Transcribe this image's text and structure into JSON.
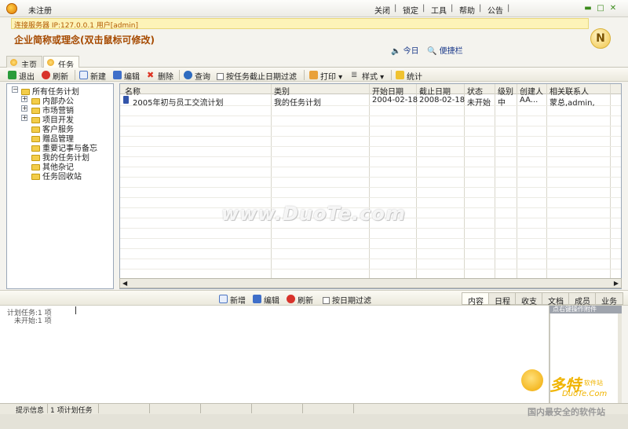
{
  "window": {
    "title": "未注册",
    "menu": [
      "关闭",
      "锁定",
      "工具",
      "帮助",
      "公告"
    ],
    "min_icon": "minimize-icon",
    "max_icon": "maximize-icon",
    "close_icon": "close-icon"
  },
  "header": {
    "connection": "连接服务器 IP:127.0.0.1 用户[admin]",
    "company": "企业简称或理念(双击鼠标可修改)",
    "today": "今日",
    "convenient": "便捷栏",
    "logo_letter": "N"
  },
  "tabs": [
    {
      "label": "主页",
      "active": false
    },
    {
      "label": "任务",
      "active": true
    }
  ],
  "toolbar": {
    "exit": "退出",
    "refresh": "刷新",
    "new": "新建",
    "edit": "编辑",
    "delete": "删除",
    "query": "查询",
    "filter_deadline": "按任务截止日期过滤",
    "print": "打印",
    "style": "样式",
    "stats": "统计"
  },
  "tree": {
    "root": "所有任务计划",
    "items": [
      "内部办公",
      "市场营销",
      "项目开发",
      "客户服务",
      "赠品管理",
      "重要记事与备忘",
      "我的任务计划",
      "其他杂记",
      "任务回收站"
    ]
  },
  "grid": {
    "columns": [
      "名称",
      "类别",
      "开始日期",
      "截止日期",
      "状态",
      "级别",
      "创建人",
      "相关联系人"
    ],
    "rows": [
      [
        "2005年初与员工交流计划",
        "我的任务计划",
        "2004-02-18",
        "2008-02-18",
        "未开始",
        "中",
        "AA...",
        "蒙总,admin,"
      ]
    ]
  },
  "lower_toolbar": {
    "add": "新增",
    "edit": "编辑",
    "refresh": "刷新",
    "filter_date": "按日期过滤",
    "tabs": [
      "内容",
      "日程",
      "收支",
      "文档",
      "成员",
      "业务"
    ]
  },
  "info": {
    "planned": "计划任务:1 项",
    "not_started": "未开始:1 项",
    "right_header": "点右键操作附件"
  },
  "statusbar": {
    "label": "提示信息",
    "value": "1 项计划任务"
  },
  "watermarks": {
    "center": "www.DuoTe.com",
    "brand": "多特",
    "brand_sub": "软件站",
    "url": "DuoTe.Com",
    "slogan": "国内最安全的软件站"
  },
  "colors": {
    "connection_text": "#b25a00",
    "company_text": "#a64a00",
    "link_text": "#1b3a8a",
    "watermark_gold": "#f0b400"
  }
}
